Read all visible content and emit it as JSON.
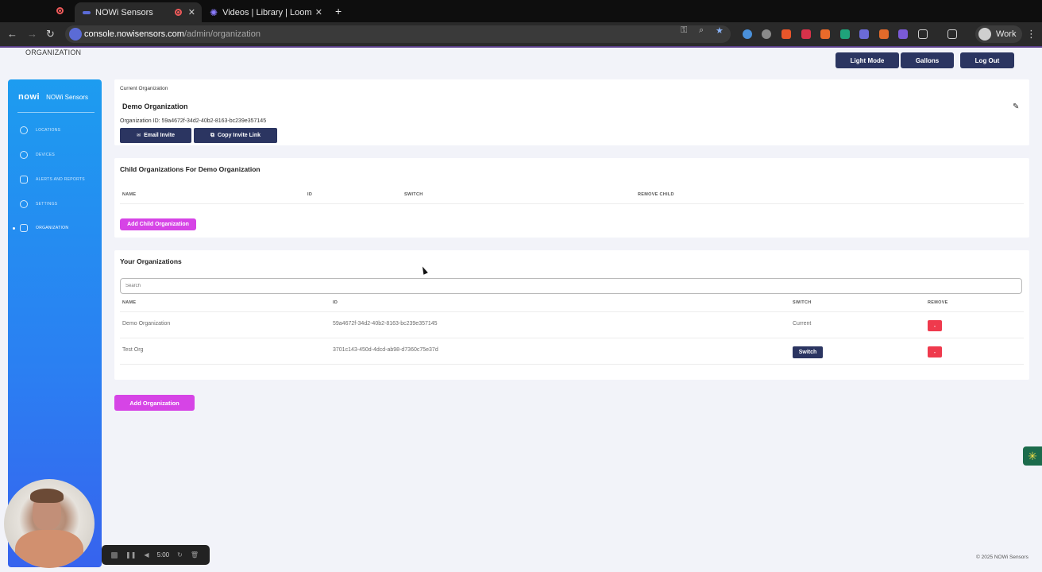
{
  "browser": {
    "tabs": [
      {
        "title": "NOWi Sensors"
      },
      {
        "title": "Videos | Library | Loom"
      }
    ],
    "url_host": "console.nowisensors.com",
    "url_path": "/admin/organization",
    "profile": "Work"
  },
  "header": {
    "page_title": "ORGANIZATION",
    "buttons": {
      "light_mode": "Light Mode",
      "gallons": "Gallons",
      "logout": "Log Out"
    }
  },
  "sidebar": {
    "logo": "nowi",
    "brand": "NOWi Sensors",
    "items": [
      {
        "label": "LOCATIONS",
        "icon": "location-icon"
      },
      {
        "label": "DEVICES",
        "icon": "power-icon"
      },
      {
        "label": "ALERTS AND REPORTS",
        "icon": "report-icon"
      },
      {
        "label": "SETTINGS",
        "icon": "gear-icon"
      },
      {
        "label": "ORGANIZATION",
        "icon": "org-chart-icon"
      }
    ],
    "active_index": 4
  },
  "current_org": {
    "label": "Current Organization",
    "name": "Demo Organization",
    "id_label": "Organization ID: 59a4672f-34d2-40b2-8163-bc239e357145",
    "email_invite": "Email Invite",
    "copy_invite": "Copy Invite Link"
  },
  "child_orgs": {
    "title": "Child Organizations For Demo Organization",
    "columns": [
      "NAME",
      "ID",
      "SWITCH",
      "REMOVE CHILD"
    ],
    "add_button": "Add Child Organization"
  },
  "your_orgs": {
    "title": "Your Organizations",
    "search_placeholder": "Search",
    "columns": [
      "NAME",
      "ID",
      "SWITCH",
      "REMOVE"
    ],
    "rows": [
      {
        "name": "Demo Organization",
        "id": "59a4672f-34d2-40b2-8163-bc239e357145",
        "switch": "Current",
        "remove": "-"
      },
      {
        "name": "Test Org",
        "id": "3701c143-450d-4dcd-ab98-d7360c75e37d",
        "switch": "Switch",
        "remove": "-"
      }
    ]
  },
  "add_org_button": "Add Organization",
  "recorder": {
    "time": "5:00"
  },
  "footer": "© 2025 NOWi Sensors"
}
